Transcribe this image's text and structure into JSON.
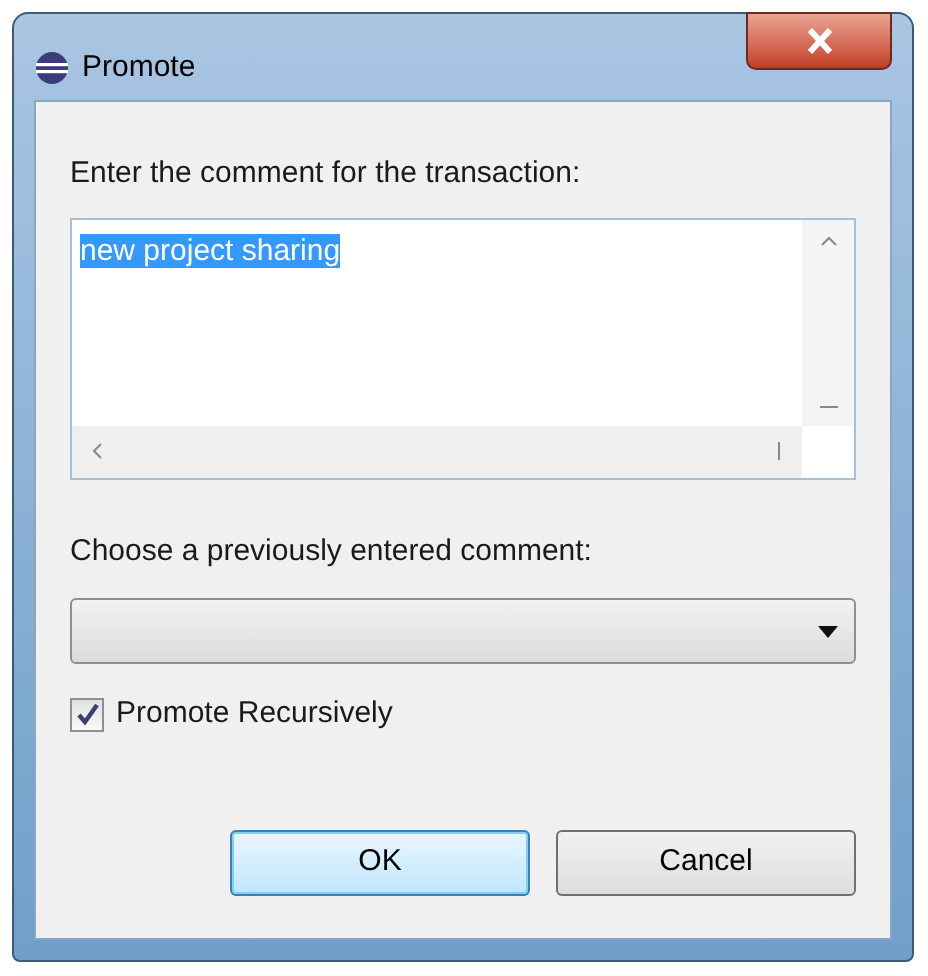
{
  "window": {
    "title": "Promote"
  },
  "comment_label": "Enter the comment for the transaction:",
  "comment": {
    "value": "new project sharing",
    "selected": true
  },
  "history_label": "Choose a previously entered comment:",
  "recursive": {
    "label": "Promote Recursively",
    "checked": true
  },
  "buttons": [
    {
      "label": "OK",
      "default": true
    },
    {
      "label": "Cancel",
      "default": false
    }
  ]
}
